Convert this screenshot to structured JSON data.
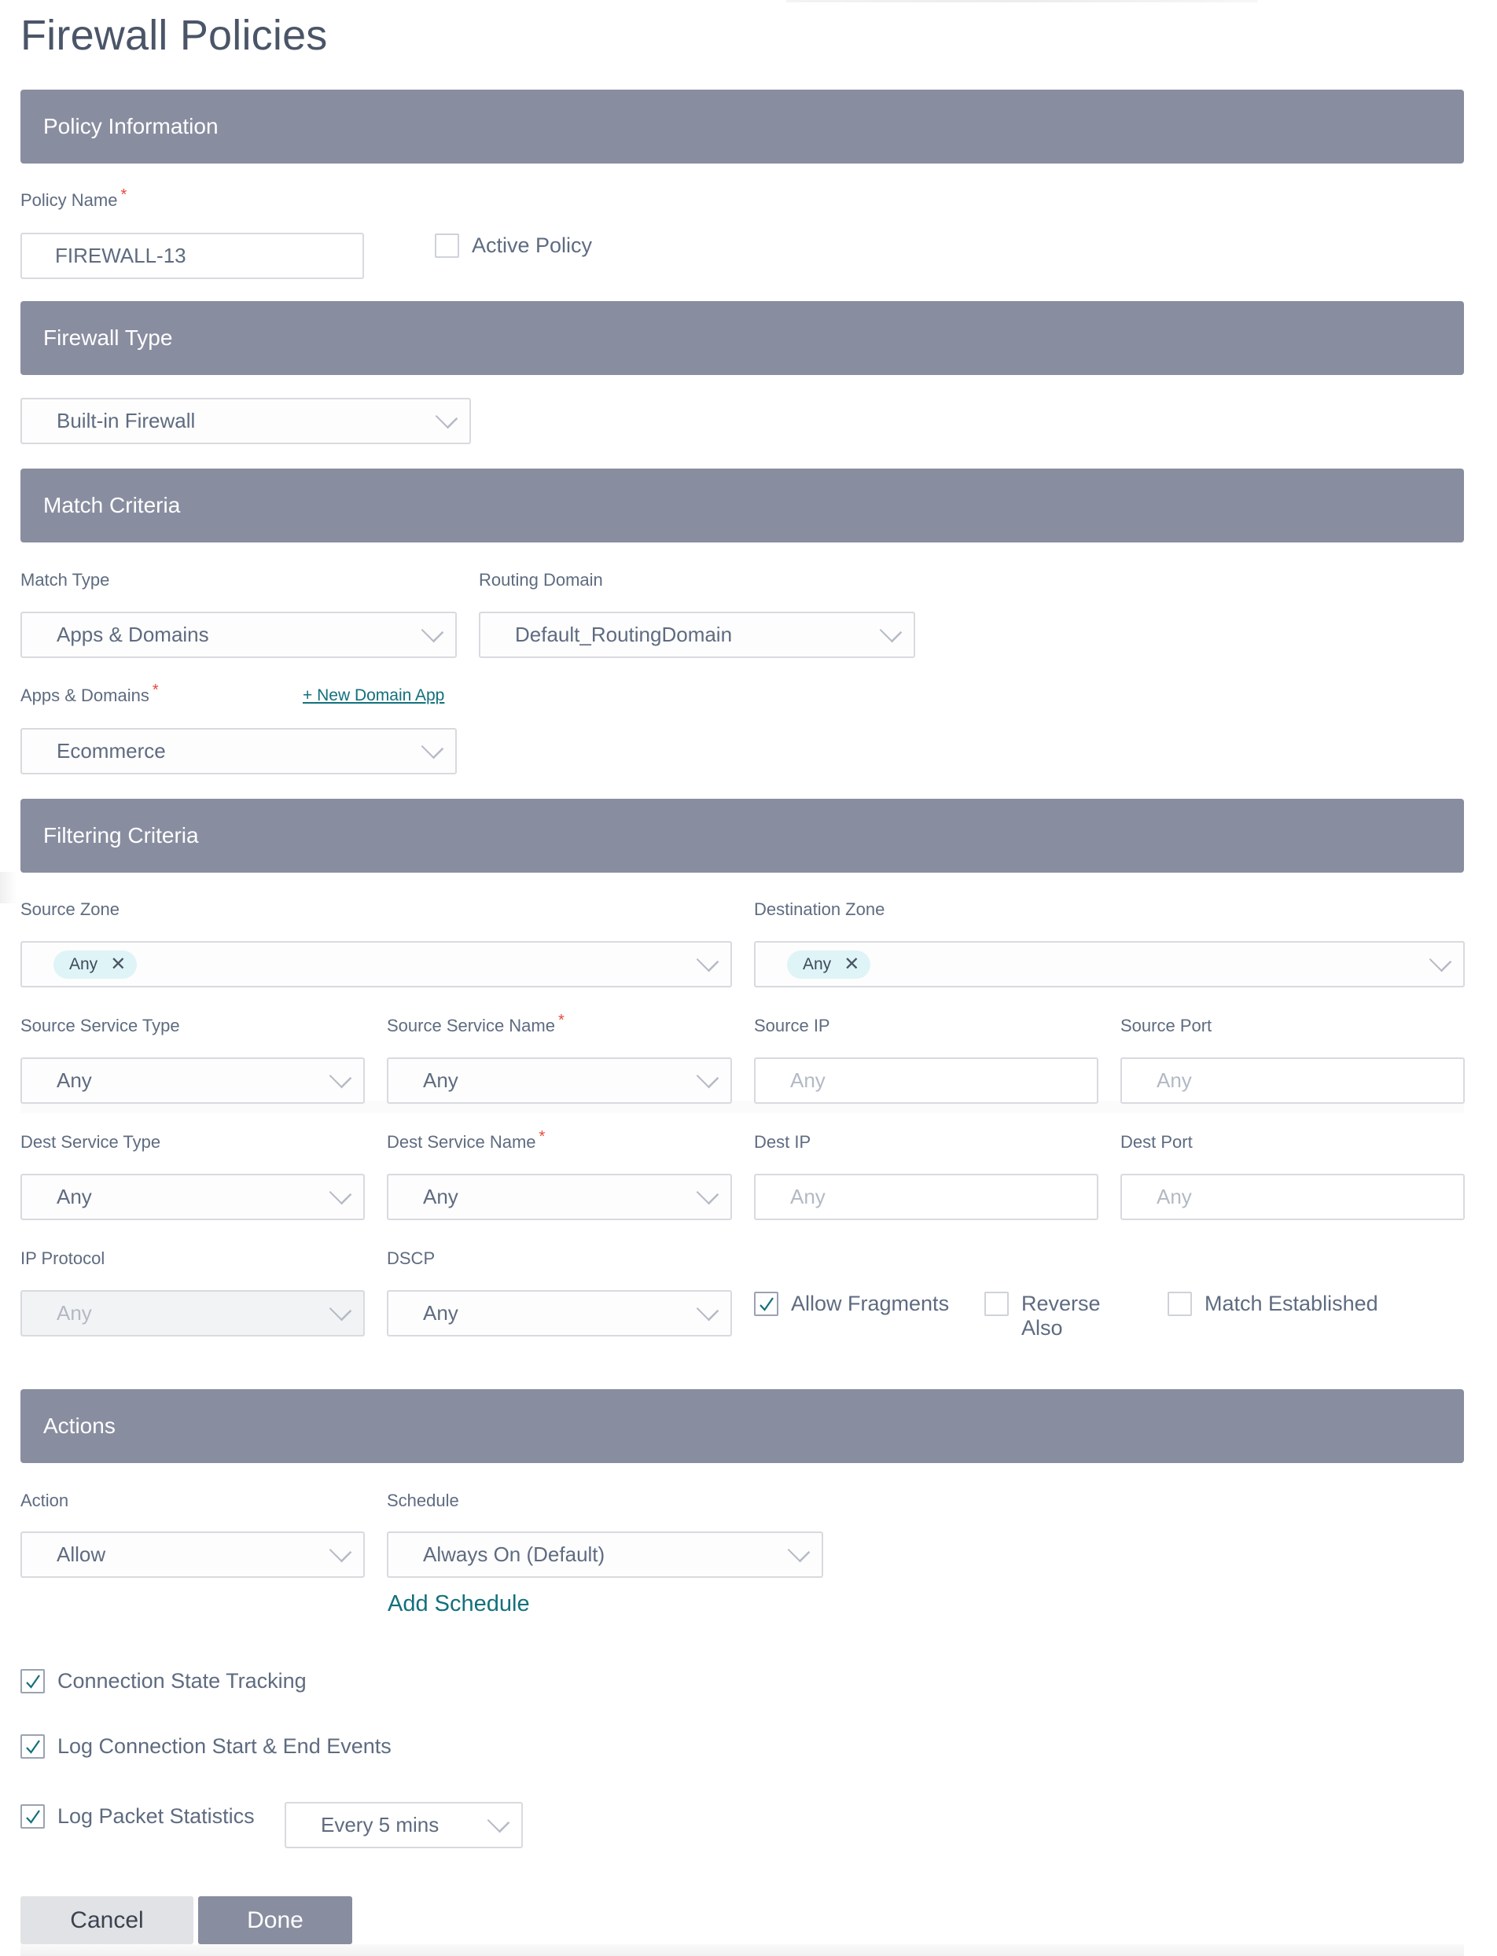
{
  "page": {
    "title": "Firewall Policies"
  },
  "sections": {
    "policy_information": "Policy Information",
    "firewall_type": "Firewall Type",
    "match_criteria": "Match Criteria",
    "filtering_criteria": "Filtering Criteria",
    "actions": "Actions"
  },
  "policy_info": {
    "policy_name_label": "Policy Name",
    "policy_name_value": "FIREWALL-13",
    "active_policy_label": "Active Policy",
    "active_policy_checked": false
  },
  "firewall_type": {
    "value": "Built-in Firewall"
  },
  "match_criteria": {
    "match_type_label": "Match Type",
    "match_type_value": "Apps & Domains",
    "routing_domain_label": "Routing Domain",
    "routing_domain_value": "Default_RoutingDomain",
    "apps_domains_label": "Apps & Domains",
    "new_domain_app_link": "+ New Domain App",
    "apps_domains_value": "Ecommerce"
  },
  "filtering": {
    "source_zone_label": "Source Zone",
    "source_zone_chip": "Any",
    "destination_zone_label": "Destination Zone",
    "destination_zone_chip": "Any",
    "source_service_type_label": "Source Service Type",
    "source_service_type_value": "Any",
    "source_service_name_label": "Source Service Name",
    "source_service_name_value": "Any",
    "source_ip_label": "Source IP",
    "source_ip_placeholder": "Any",
    "source_port_label": "Source Port",
    "source_port_placeholder": "Any",
    "dest_service_type_label": "Dest Service Type",
    "dest_service_type_value": "Any",
    "dest_service_name_label": "Dest Service Name",
    "dest_service_name_value": "Any",
    "dest_ip_label": "Dest IP",
    "dest_ip_placeholder": "Any",
    "dest_port_label": "Dest Port",
    "dest_port_placeholder": "Any",
    "ip_protocol_label": "IP Protocol",
    "ip_protocol_value": "Any",
    "dscp_label": "DSCP",
    "dscp_value": "Any",
    "allow_fragments_label": "Allow Fragments",
    "allow_fragments_checked": true,
    "reverse_also_label_line1": "Reverse",
    "reverse_also_label_line2": "Also",
    "reverse_also_checked": false,
    "match_established_label": "Match Established",
    "match_established_checked": false
  },
  "actions": {
    "action_label": "Action",
    "action_value": "Allow",
    "schedule_label": "Schedule",
    "schedule_value": "Always On (Default)",
    "add_schedule_link": "Add Schedule",
    "connection_state_tracking_label": "Connection State Tracking",
    "connection_state_tracking_checked": true,
    "log_connection_label": "Log Connection Start & End Events",
    "log_connection_checked": true,
    "log_packet_stats_label": "Log Packet Statistics",
    "log_packet_stats_checked": true,
    "log_interval_value": "Every 5 mins"
  },
  "buttons": {
    "cancel": "Cancel",
    "done": "Done"
  },
  "colors": {
    "section_header_bg": "#898da0",
    "link": "#13707c",
    "required_asterisk": "#e5483d",
    "chip_bg": "#dff4f6",
    "checkmark": "#13707c"
  }
}
